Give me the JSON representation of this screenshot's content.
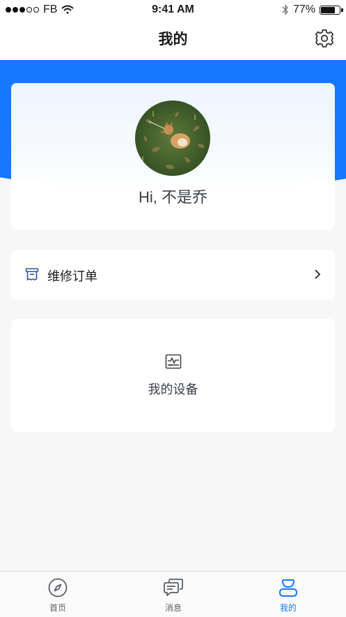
{
  "status_bar": {
    "carrier": "FB",
    "time": "9:41 AM",
    "battery": "77%",
    "battery_level": 0.77
  },
  "nav": {
    "title": "我的",
    "settings_icon": "gear-icon"
  },
  "profile": {
    "greeting": "Hi, 不是乔",
    "avatar": "avatar-photo"
  },
  "menu": {
    "orders_label": "维修订单",
    "devices_label": "我的设备"
  },
  "tabs": [
    {
      "label": "首页",
      "icon": "compass-icon",
      "active": false
    },
    {
      "label": "消息",
      "icon": "message-icon",
      "active": false
    },
    {
      "label": "我的",
      "icon": "user-icon",
      "active": true
    }
  ],
  "colors": {
    "accent": "#1677ff",
    "background": "#f7f7f8"
  }
}
